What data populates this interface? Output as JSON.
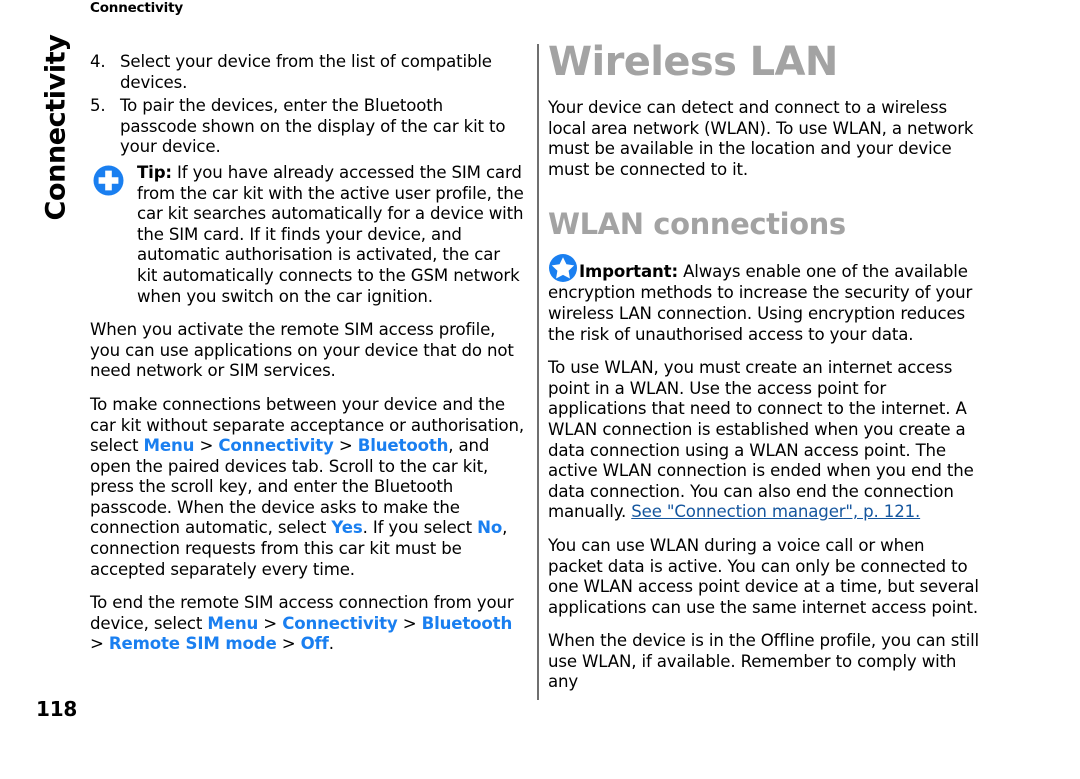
{
  "page": {
    "running_header": "Connectivity",
    "chapter_tab": "Connectivity",
    "page_number": "118"
  },
  "colors": {
    "ui_path_blue": "#1a7ff0",
    "xref_blue": "#15569e",
    "heading_gray": "#a3a3a3",
    "icon_blue": "#1a7ff0",
    "rule_gray": "#6f6f6f",
    "text_black": "#000000"
  },
  "left_column": {
    "list_items": [
      {
        "number": "4.",
        "text": "Select your device from the list of compatible devices."
      },
      {
        "number": "5.",
        "text": "To pair the devices, enter the Bluetooth passcode shown on the display of the car kit to your device."
      }
    ],
    "tip": {
      "icon": "plus-circle-icon",
      "label": "Tip:",
      "text": " If you have already accessed the SIM card from the car kit with the active user profile, the car kit searches automatically for a device with the SIM card. If it finds your device, and automatic authorisation is activated, the car kit automatically connects to the GSM network when you switch on the car ignition."
    },
    "paragraph_1": "When you activate the remote SIM access profile, you can use applications on your device that do not need network or SIM services.",
    "paragraph_2": {
      "part_1": "To make connections between your device and the car kit without separate acceptance or authorisation, select ",
      "path_1": "Menu",
      "sep_1": " > ",
      "path_2": "Connectivity",
      "sep_2": " > ",
      "path_3": "Bluetooth",
      "part_2": ", and open the paired devices tab. Scroll to the car kit, press the scroll key, and enter the Bluetooth passcode. When the device asks to make the connection automatic, select ",
      "path_4": "Yes",
      "part_3": ". If you select ",
      "path_5": "No",
      "part_4": ", connection requests from this car kit must be accepted separately every time."
    },
    "paragraph_3": {
      "part_1": "To end the remote SIM access connection from your device, select ",
      "path_1": "Menu",
      "sep_1": " > ",
      "path_2": "Connectivity",
      "sep_2": " > ",
      "path_3": "Bluetooth",
      "sep_3": " > ",
      "path_4": "Remote SIM mode",
      "sep_4": " > ",
      "path_5": "Off",
      "part_2": "."
    }
  },
  "right_column": {
    "heading_1": "Wireless LAN",
    "intro_paragraph": "Your device can detect and connect to a wireless local area network (WLAN). To use WLAN, a network must be available in the location and your device must be connected to it.",
    "heading_2": "WLAN connections",
    "important": {
      "icon": "star-circle-icon",
      "label": "Important:",
      "text": " Always enable one of the available encryption methods to increase the security of your wireless LAN connection. Using encryption reduces the risk of unauthorised access to your data."
    },
    "paragraph_1": {
      "part_1": "To use WLAN, you must create an internet access point in a WLAN. Use the access point for applications that need to connect to the internet. A WLAN connection is established when you create a data connection using a WLAN access point. The active WLAN connection is ended when you end the data connection. You can also end the connection manually. ",
      "xref": "See \"Connection manager\", p. 121.",
      "part_2": ""
    },
    "paragraph_2": "You can use WLAN during a voice call or when packet data is active. You can only be connected to one WLAN access point device at a time, but several applications can use the same internet access point.",
    "paragraph_3": "When the device is in the Offline profile, you can still use WLAN, if available. Remember to comply with any"
  }
}
